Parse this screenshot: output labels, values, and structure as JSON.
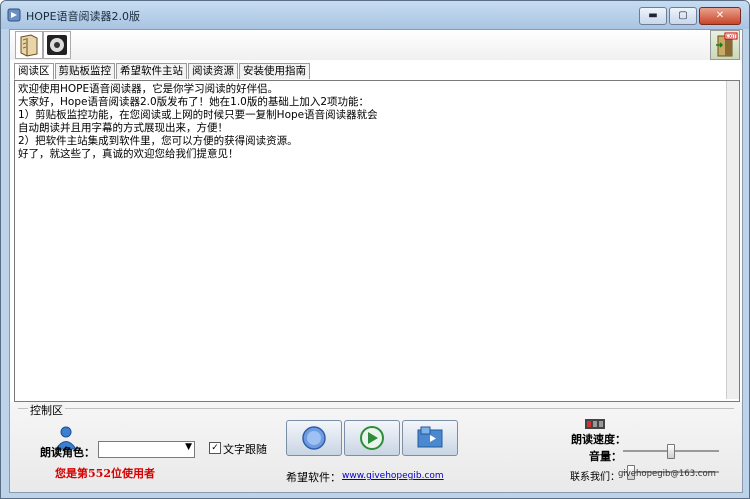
{
  "window": {
    "title": "HOPE语音阅读器2.0版",
    "minimize_glyph": "▬",
    "maximize_glyph": "▢",
    "close_glyph": "✕"
  },
  "toolbar": {
    "exit_label": "EXIT"
  },
  "tabs": [
    {
      "label": "阅读区"
    },
    {
      "label": "剪贴板监控"
    },
    {
      "label": "希望软件主站"
    },
    {
      "label": "阅读资源"
    },
    {
      "label": "安装使用指南"
    }
  ],
  "reading": {
    "text": "欢迎使用HOPE语音阅读器，它是你学习阅读的好伴侣。\n大家好，Hope语音阅读器2.0版发布了！她在1.0版的基础上加入2项功能：\n1）剪贴板监控功能，在您阅读或上网的时候只要一复制Hope语音阅读器就会\n自动朗读并且用字幕的方式展现出来，方便！\n2）把软件主站集成到软件里，您可以方便的获得阅读资源。\n好了，就这些了，真诚的欢迎您给我们提意见！"
  },
  "control": {
    "group_label": "控制区",
    "role_label": "朗读角色：",
    "role_value": "",
    "follow_label": "文字跟随",
    "follow_checked": "✓",
    "count_text": "您是第552位使用者",
    "hope_label": "希望软件：",
    "hope_url": "www.givehopegib.com",
    "speed_label": "朗读速度：",
    "volume_label": "音量：",
    "speed_level": 0.5,
    "volume_level": 0.05,
    "contact_label": "联系我们：",
    "contact_email": "givehopegib@163.com"
  }
}
